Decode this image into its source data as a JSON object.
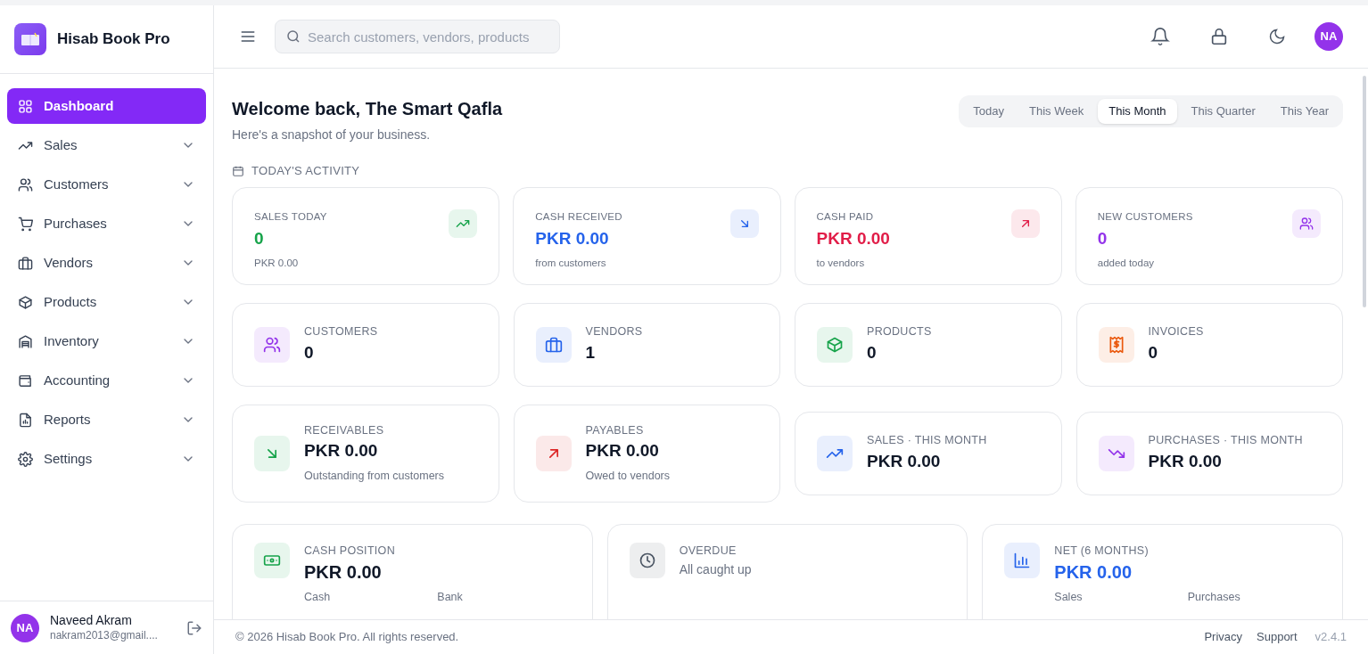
{
  "app": {
    "name": "Hisab Book Pro"
  },
  "sidebar": {
    "items": [
      {
        "label": "Dashboard",
        "selected": true
      },
      {
        "label": "Sales",
        "selected": false,
        "expanded": false
      },
      {
        "label": "Customers",
        "selected": false,
        "expanded": false
      },
      {
        "label": "Purchases",
        "selected": false,
        "expanded": false
      },
      {
        "label": "Vendors",
        "selected": false,
        "expanded": false
      },
      {
        "label": "Products",
        "selected": false,
        "expanded": false
      },
      {
        "label": "Inventory",
        "selected": false,
        "expanded": false
      },
      {
        "label": "Accounting",
        "selected": false,
        "expanded": false
      },
      {
        "label": "Reports",
        "selected": false,
        "expanded": false
      },
      {
        "label": "Settings",
        "selected": false,
        "expanded": false
      }
    ],
    "user": {
      "initials": "NA",
      "name": "Naveed Akram",
      "email": "nakram2013@gmail...."
    }
  },
  "header": {
    "search": {
      "placeholder": "Search customers, vendors, products"
    },
    "avatar": "NA"
  },
  "welcome": {
    "title": "Welcome back, The Smart Qafla",
    "subtitle": "Here's a snapshot of your business."
  },
  "periods": [
    {
      "label": "Today",
      "selected": false
    },
    {
      "label": "This Week",
      "selected": false
    },
    {
      "label": "This Month",
      "selected": true
    },
    {
      "label": "This Quarter",
      "selected": false
    },
    {
      "label": "This Year",
      "selected": false
    }
  ],
  "activity": {
    "heading": "TODAY'S ACTIVITY",
    "cards": [
      {
        "label": "SALES TODAY",
        "value": "0",
        "note": "PKR 0.00",
        "color": "#16a34a"
      },
      {
        "label": "CASH RECEIVED",
        "value": "PKR 0.00",
        "note": "from customers",
        "color": "#2563eb"
      },
      {
        "label": "CASH PAID",
        "value": "PKR 0.00",
        "note": "to vendors",
        "color": "#e11d48"
      },
      {
        "label": "NEW CUSTOMERS",
        "value": "0",
        "note": "added today",
        "color": "#9333ea"
      }
    ]
  },
  "counts": [
    {
      "label": "CUSTOMERS",
      "value": "0",
      "color": "#9333ea"
    },
    {
      "label": "VENDORS",
      "value": "1",
      "color": "#2563eb"
    },
    {
      "label": "PRODUCTS",
      "value": "0",
      "color": "#16a34a"
    },
    {
      "label": "INVOICES",
      "value": "0",
      "color": "#ea580c"
    }
  ],
  "balances": [
    {
      "label": "RECEIVABLES",
      "value": "PKR 0.00",
      "note": "Outstanding from customers",
      "color": "#16a34a"
    },
    {
      "label": "PAYABLES",
      "value": "PKR 0.00",
      "note": "Owed to vendors",
      "color": "#dc2626"
    },
    {
      "label": "SALES · THIS MONTH",
      "value": "PKR 0.00",
      "color": "#2563eb"
    },
    {
      "label": "PURCHASES · THIS MONTH",
      "value": "PKR 0.00",
      "color": "#9333ea"
    }
  ],
  "summary": [
    {
      "label": "CASH POSITION",
      "value": "PKR 0.00",
      "parts": [
        "Cash",
        "Bank"
      ],
      "color": "#16a34a"
    },
    {
      "label": "OVERDUE",
      "note": "All caught up",
      "color": "#4b5563"
    },
    {
      "label": "NET (6 MONTHS)",
      "value": "PKR 0.00",
      "parts": [
        "Sales",
        "Purchases"
      ],
      "color": "#2563eb"
    }
  ],
  "footer": {
    "copyright": "© 2026 Hisab Book Pro. All rights reserved.",
    "links": [
      "Privacy",
      "Support"
    ],
    "version": "v2.4.1"
  }
}
